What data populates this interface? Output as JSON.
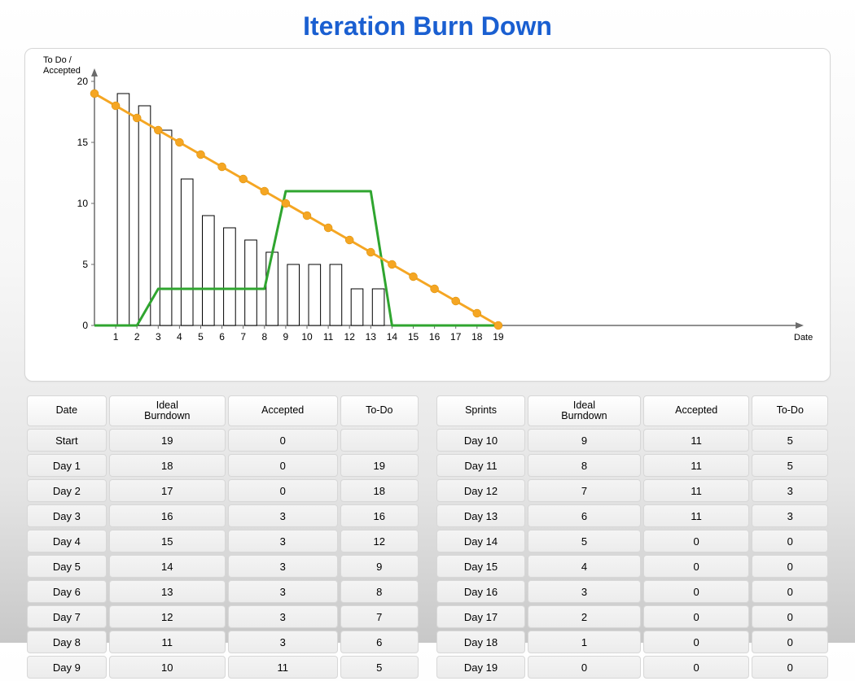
{
  "title": "Iteration Burn Down",
  "axis": {
    "ylabel1": "To Do /",
    "ylabel2": "Accepted",
    "xlabel": "Date"
  },
  "table_headers_left": [
    "Date",
    "Ideal Burndown",
    "Accepted",
    "To-Do"
  ],
  "table_headers_right": [
    "Sprints",
    "Ideal Burndown",
    "Accepted",
    "To-Do"
  ],
  "chart_data": {
    "type": "bar",
    "title": "Iteration Burn Down",
    "xlabel": "Date",
    "ylabel": "To Do / Accepted",
    "ylim": [
      0,
      20
    ],
    "yticks": [
      0,
      5,
      10,
      15,
      20
    ],
    "categories_x": [
      0,
      1,
      2,
      3,
      4,
      5,
      6,
      7,
      8,
      9,
      10,
      11,
      12,
      13,
      14,
      15,
      16,
      17,
      18,
      19
    ],
    "categories": [
      "Start",
      "Day 1",
      "Day 2",
      "Day 3",
      "Day 4",
      "Day 5",
      "Day 6",
      "Day 7",
      "Day 8",
      "Day 9",
      "Day 10",
      "Day 11",
      "Day 12",
      "Day 13",
      "Day 14",
      "Day 15",
      "Day 16",
      "Day 17",
      "Day 18",
      "Day 19"
    ],
    "series": [
      {
        "name": "Ideal Burndown",
        "style": "line-marker",
        "color": "#F5A623",
        "values": [
          19,
          18,
          17,
          16,
          15,
          14,
          13,
          12,
          11,
          10,
          9,
          8,
          7,
          6,
          5,
          4,
          3,
          2,
          1,
          0
        ]
      },
      {
        "name": "Accepted",
        "style": "line",
        "color": "#2FA52F",
        "values": [
          0,
          0,
          0,
          3,
          3,
          3,
          3,
          3,
          3,
          11,
          11,
          11,
          11,
          11,
          0,
          0,
          0,
          0,
          0,
          0
        ]
      },
      {
        "name": "To-Do",
        "style": "bar",
        "color": "#000000",
        "values": [
          null,
          19,
          18,
          16,
          12,
          9,
          8,
          7,
          6,
          5,
          5,
          5,
          3,
          3,
          0,
          0,
          0,
          0,
          0,
          0
        ]
      }
    ]
  }
}
